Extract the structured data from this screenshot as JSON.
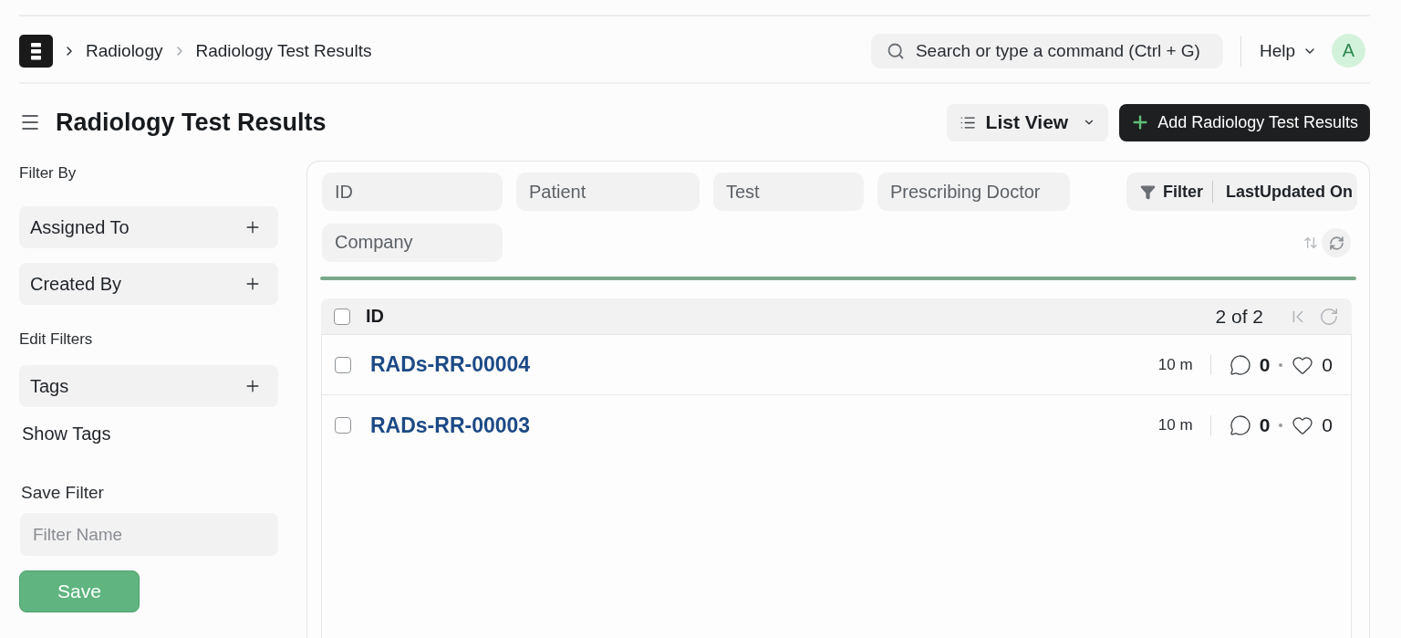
{
  "navbar": {
    "breadcrumbs": [
      "Radiology",
      "Radiology Test Results"
    ],
    "search": {
      "placeholder": "Search or type a command (Ctrl + G)"
    },
    "help": "Help",
    "avatar": "A"
  },
  "page_header": {
    "title": "Radiology Test Results",
    "view_switcher": "List View",
    "primary_action": "Add Radiology Test Results"
  },
  "sidebar": {
    "filter_by": {
      "heading": "Filter By",
      "items": [
        "Assigned To",
        "Created By"
      ]
    },
    "edit_filters": {
      "heading": "Edit Filters",
      "items": [
        "Tags"
      ],
      "toggle": "Show Tags"
    },
    "save_filter": {
      "heading": "Save Filter",
      "placeholder": "Filter Name",
      "button": "Save"
    }
  },
  "filters": {
    "fields": [
      {
        "placeholder": "ID"
      },
      {
        "placeholder": "Patient"
      },
      {
        "placeholder": "Test"
      },
      {
        "placeholder": "Prescribing Doctor"
      },
      {
        "placeholder": "Company"
      }
    ],
    "filter_button": "Filter",
    "sort_button": "LastUpdated On"
  },
  "list": {
    "header": {
      "checked": false,
      "column": "ID",
      "count": "2 of 2"
    },
    "rows": [
      {
        "checked": false,
        "id": "RADs-RR-00004",
        "modified": "10 m",
        "comments": "0",
        "likes": "0"
      },
      {
        "checked": false,
        "id": "RADs-RR-00003",
        "modified": "10 m",
        "comments": "0",
        "likes": "0"
      }
    ]
  }
}
